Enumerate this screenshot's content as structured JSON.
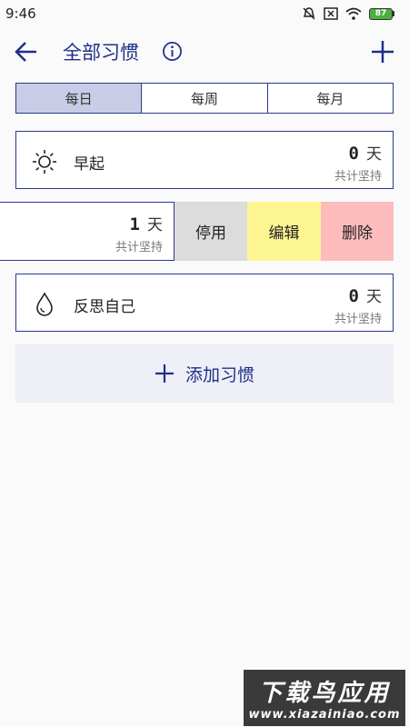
{
  "status_bar": {
    "time": "9:46",
    "battery": "87"
  },
  "header": {
    "title": "全部习惯"
  },
  "tabs": [
    {
      "label": "每日",
      "active": true
    },
    {
      "label": "每周",
      "active": false
    },
    {
      "label": "每月",
      "active": false
    }
  ],
  "habits": [
    {
      "name": "早起",
      "icon": "sun-icon",
      "count": "0",
      "unit": "天",
      "total_label": "共计坚持"
    },
    {
      "name": "",
      "icon": "",
      "count": "1",
      "unit": "天",
      "total_label": "共计坚持",
      "swiped": true
    },
    {
      "name": "反思自己",
      "icon": "water-drop-icon",
      "count": "0",
      "unit": "天",
      "total_label": "共计坚持"
    }
  ],
  "swipe_actions": {
    "disable": "停用",
    "edit": "编辑",
    "delete": "删除"
  },
  "add_habit_label": "添加习惯",
  "watermark": {
    "main": "下载鸟应用",
    "sub": "www.xiazainiao.com"
  },
  "colors": {
    "accent": "#2b3990",
    "tab_active": "#c9cce6",
    "disable": "#dcdcdc",
    "edit": "#fdf592",
    "delete": "#fcbcbc",
    "add_bg": "#eeeff7"
  }
}
